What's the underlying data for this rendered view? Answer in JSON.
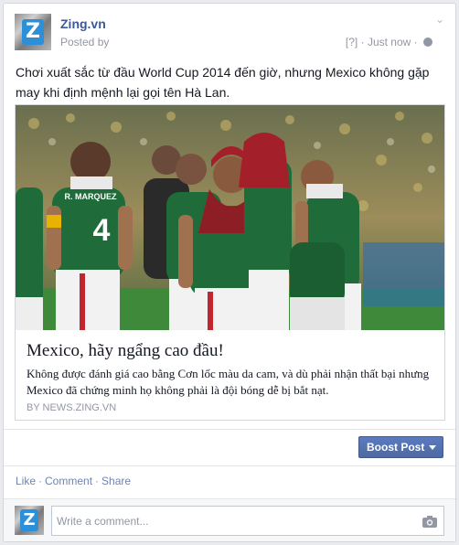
{
  "post": {
    "page_name": "Zing.vn",
    "posted_by": "Posted by",
    "audience_tag": "[?]",
    "separator": "·",
    "timestamp": "Just now",
    "text": "Chơi xuất sắc từ đầu World Cup 2014 đến giờ, nhưng Mexico không gặp may khi định mệnh lại gọi tên Hà Lan."
  },
  "link": {
    "title": "Mexico, hãy ngẩng cao đầu!",
    "description": "Không được đánh giá cao bằng Cơn lốc màu da cam, và dù phải nhận thất bại nhưng Mexico đã chứng minh họ không phải là đội bóng dễ bị bắt nạt.",
    "source": "BY NEWS.ZING.VN",
    "jersey_name": "R. MARQUEZ",
    "jersey_number": "4"
  },
  "boost_label": "Boost Post",
  "actions": {
    "like": "Like",
    "comment": "Comment",
    "share": "Share",
    "sep": "·"
  },
  "comment": {
    "placeholder": "Write a comment..."
  },
  "colors": {
    "link_blue": "#3b5998",
    "boost_blue": "#4e69a2",
    "muted_gray": "#9197a3",
    "jersey_green": "#1f6b3a",
    "pitch_green": "#3f8a3a"
  },
  "icons": [
    "globe-icon",
    "chevron-down-icon",
    "camera-icon",
    "dropdown-arrow-icon"
  ]
}
